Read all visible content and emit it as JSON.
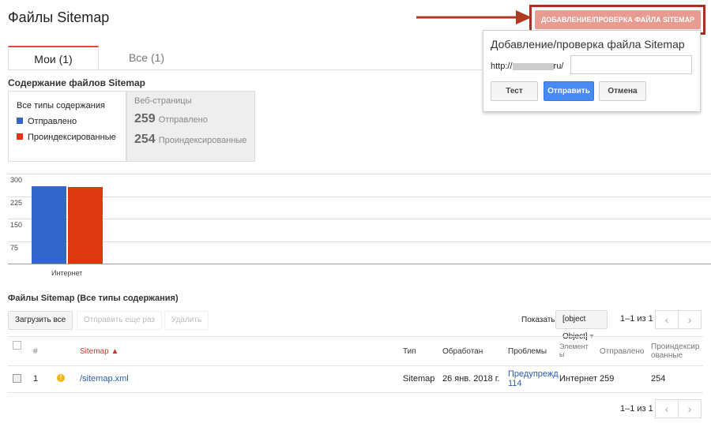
{
  "header": {
    "title": "Файлы Sitemap",
    "add_button": "ДОБАВЛЕНИЕ/ПРОВЕРКА ФАЙЛА SITEMAP"
  },
  "tabs": [
    {
      "label": "Мои (1)"
    },
    {
      "label": "Все (1)"
    }
  ],
  "content_section": {
    "title": "Содержание файлов Sitemap",
    "legend_title": "Все типы содержания",
    "legend": [
      {
        "label": "Отправлено",
        "color": "#3366cc"
      },
      {
        "label": "Проиндексированные",
        "color": "#dc3912"
      }
    ],
    "webpages": {
      "title": "Веб-страницы",
      "submitted": "259",
      "submitted_label": "Отправлено",
      "indexed": "254",
      "indexed_label": "Проиндексированные"
    }
  },
  "chart_data": {
    "type": "bar",
    "categories": [
      "Интернет"
    ],
    "series": [
      {
        "name": "Отправлено",
        "values": [
          259
        ],
        "color": "#3366cc"
      },
      {
        "name": "Проиндексированные",
        "values": [
          254
        ],
        "color": "#dc3912"
      }
    ],
    "yticks": [
      "300",
      "225",
      "150",
      "75"
    ],
    "ylim": [
      0,
      300
    ]
  },
  "popup": {
    "title": "Добавление/проверка файла Sitemap",
    "prefix": "http://",
    "suffix": "ru/",
    "input_value": "",
    "test": "Тест",
    "submit": "Отправить",
    "cancel": "Отмена"
  },
  "files": {
    "title": "Файлы Sitemap (Все типы содержания)",
    "load_all": "Загрузить все",
    "resend": "Отправить еще раз",
    "delete": "Удалить",
    "show": "Показать",
    "rows": [
      {
        "num": "1",
        "sitemap": "/sitemap.xml",
        "type": "Sitemap",
        "processed": "26 янв. 2018 г.",
        "issues": "Предупрежд.",
        "issues_count": "114",
        "elements": "Интернет",
        "submitted": "259",
        "indexed": "254"
      }
    ],
    "range": "1–1 из 1",
    "columns": [
      "#",
      "Sitemap ▲",
      "Тип",
      "Обработан",
      "Проблемы",
      "Элемент ы",
      "Отправлено",
      "Проиндексир ованные"
    ]
  }
}
